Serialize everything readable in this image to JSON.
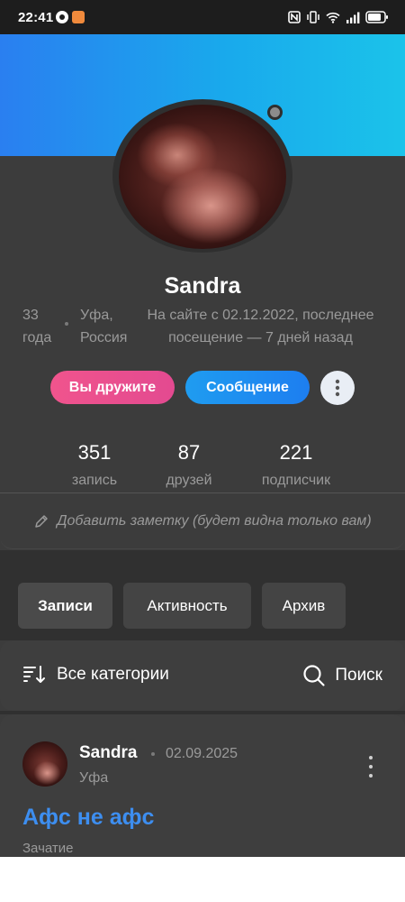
{
  "status_bar": {
    "time": "22:41",
    "icons": [
      "app-notification-icon",
      "app-notification-icon",
      "nfc-icon",
      "vibrate-icon",
      "wifi-icon",
      "signal-icon",
      "battery-icon"
    ]
  },
  "profile": {
    "name": "Sandra",
    "age": "33 года",
    "city": "Уфа, Россия",
    "last_seen": "На сайте с 02.12.2022, последнее посещение — 7 дней назад",
    "online_status": "offline"
  },
  "actions": {
    "friends_label": "Вы дружите",
    "message_label": "Сообщение",
    "more_icon": "more-vertical-icon"
  },
  "stats": [
    {
      "value": "351",
      "label": "запись"
    },
    {
      "value": "87",
      "label": "друзей"
    },
    {
      "value": "221",
      "label": "подписчик"
    }
  ],
  "note": {
    "placeholder": "Добавить заметку (будет видна только вам)",
    "icon": "pencil-icon"
  },
  "tabs": [
    {
      "label": "Записи",
      "active": true
    },
    {
      "label": "Активность",
      "active": false
    },
    {
      "label": "Архив",
      "active": false
    }
  ],
  "filter": {
    "categories_label": "Все категории",
    "search_label": "Поиск"
  },
  "post": {
    "author": "Sandra",
    "date": "02.09.2025",
    "city": "Уфа",
    "title": "Афс не афс",
    "category": "Зачатие"
  },
  "colors": {
    "accent_pink": "#e94d8f",
    "accent_blue": "#1d8cf0",
    "link_blue": "#3d8ef0",
    "background": "#3c3c3c",
    "cover_start": "#2a7ff0",
    "cover_end": "#1bc3ea"
  }
}
